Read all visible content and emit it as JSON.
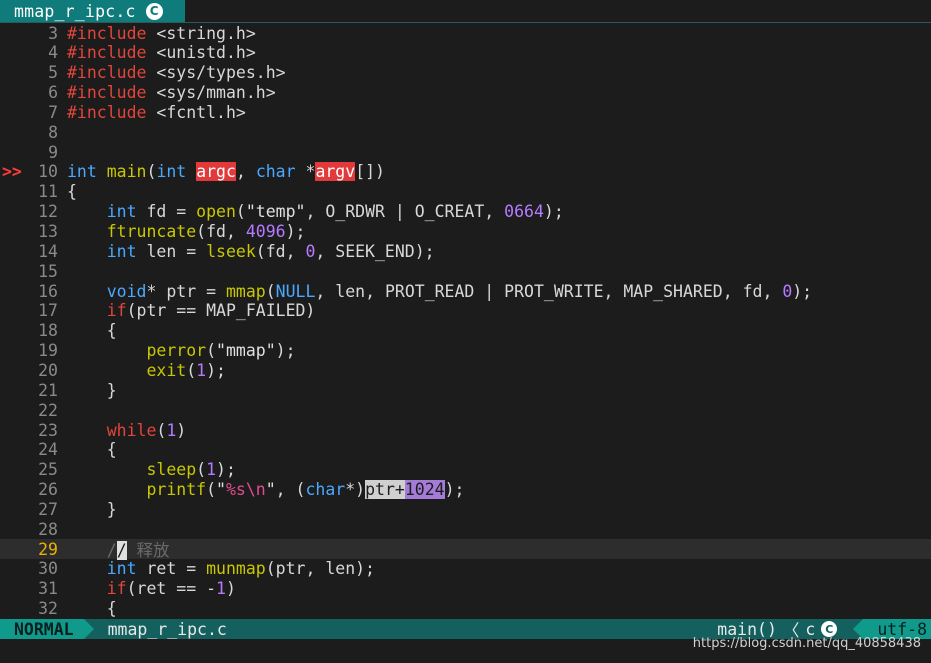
{
  "tab": {
    "filename": "mmap_r_ipc.c",
    "icon": "c-language-icon",
    "badge": "C"
  },
  "editor": {
    "lines": [
      {
        "num": "3",
        "sign": "",
        "html": "<span class='pre'>#include</span> &lt;string.h&gt;"
      },
      {
        "num": "4",
        "sign": "",
        "html": "<span class='pre'>#include</span> &lt;unistd.h&gt;"
      },
      {
        "num": "5",
        "sign": "",
        "html": "<span class='pre'>#include</span> &lt;sys/types.h&gt;"
      },
      {
        "num": "6",
        "sign": "",
        "html": "<span class='pre'>#include</span> &lt;sys/mman.h&gt;"
      },
      {
        "num": "7",
        "sign": "",
        "html": "<span class='pre'>#include</span> &lt;fcntl.h&gt;"
      },
      {
        "num": "8",
        "sign": "",
        "html": ""
      },
      {
        "num": "9",
        "sign": "",
        "html": ""
      },
      {
        "num": "10",
        "sign": ">>",
        "html": "<span class='kw'>int</span> <span class='fn'>main</span>(<span class='kw'>int</span> <span class='hl-red'>argc</span>, <span class='kw'>char</span> *<span class='hl-red'>argv</span>[])"
      },
      {
        "num": "11",
        "sign": "",
        "html": "{"
      },
      {
        "num": "12",
        "sign": "",
        "html": "    <span class='kw'>int</span> fd = <span class='fn'>open</span>(<span class='str'>\"temp\"</span>, O_RDWR | O_CREAT, <span class='num'>0664</span>);"
      },
      {
        "num": "13",
        "sign": "",
        "html": "    <span class='fn'>ftruncate</span>(fd, <span class='num'>4096</span>);"
      },
      {
        "num": "14",
        "sign": "",
        "html": "    <span class='kw'>int</span> len = <span class='fn'>lseek</span>(fd, <span class='num'>0</span>, SEEK_END);"
      },
      {
        "num": "15",
        "sign": "",
        "html": ""
      },
      {
        "num": "16",
        "sign": "",
        "html": "    <span class='kw'>void</span>* ptr = <span class='fn'>mmap</span>(<span class='kw'>NULL</span>, len, PROT_READ | PROT_WRITE, MAP_SHARED, fd, <span class='num'>0</span>);"
      },
      {
        "num": "17",
        "sign": "",
        "html": "    <span class='ctrl'>if</span>(ptr == MAP_FAILED)"
      },
      {
        "num": "18",
        "sign": "",
        "html": "    {"
      },
      {
        "num": "19",
        "sign": "",
        "html": "        <span class='fn'>perror</span>(<span class='str'>\"mmap\"</span>);"
      },
      {
        "num": "20",
        "sign": "",
        "html": "        <span class='fn'>exit</span>(<span class='num'>1</span>);"
      },
      {
        "num": "21",
        "sign": "",
        "html": "    }"
      },
      {
        "num": "22",
        "sign": "",
        "html": ""
      },
      {
        "num": "23",
        "sign": "",
        "html": "    <span class='ctrl'>while</span>(<span class='num'>1</span>)"
      },
      {
        "num": "24",
        "sign": "",
        "html": "    {"
      },
      {
        "num": "25",
        "sign": "",
        "html": "        <span class='fn'>sleep</span>(<span class='num'>1</span>);"
      },
      {
        "num": "26",
        "sign": "",
        "html": "        <span class='fn'>printf</span>(<span class='str'>\"</span><span class='esc'>%s\\n</span><span class='str'>\"</span>, (<span class='kw'>char</span>*)<span class='hl-vis'>ptr+</span><span class='hl-visnum'>1024</span>);"
      },
      {
        "num": "27",
        "sign": "",
        "html": "    }"
      },
      {
        "num": "28",
        "sign": "",
        "html": ""
      },
      {
        "num": "29",
        "sign": "",
        "cursor": true,
        "html": "    <span class='cmt'>/</span><span class='cur-block'>/</span><span class='cmt'> 释放</span>"
      },
      {
        "num": "30",
        "sign": "",
        "html": "    <span class='kw'>int</span> ret = <span class='fn'>munmap</span>(ptr, len);"
      },
      {
        "num": "31",
        "sign": "",
        "html": "    <span class='ctrl'>if</span>(ret == -<span class='num'>1</span>)"
      },
      {
        "num": "32",
        "sign": "",
        "html": "    {"
      }
    ]
  },
  "status": {
    "mode": "NORMAL",
    "filename": "mmap_r_ipc.c",
    "function": "main()",
    "separator": "〈",
    "filetype": "c",
    "badge": "C",
    "encoding": "utf-8"
  },
  "watermark": "https://blog.csdn.net/qq_40858438",
  "colors": {
    "accent": "#0f7b7b",
    "statusbar": "#14605f",
    "mode": "#0f9a8c",
    "background": "#1c1c1c"
  }
}
